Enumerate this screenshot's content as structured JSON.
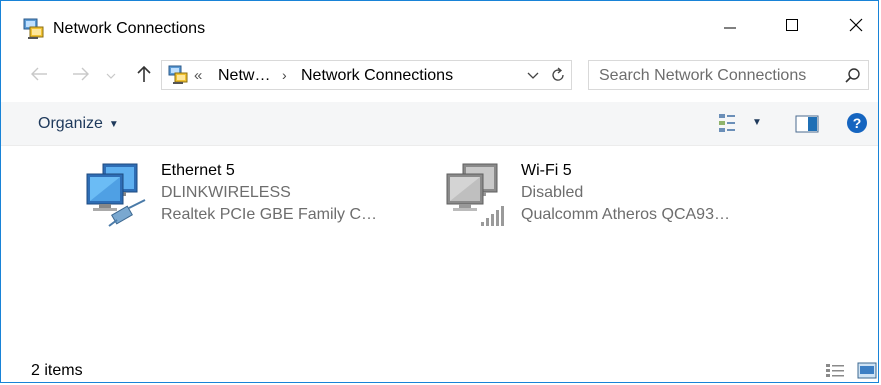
{
  "window": {
    "title": "Network Connections",
    "icon": "network-connections-icon"
  },
  "caption_buttons": {
    "minimize": "minimize-icon",
    "maximize": "maximize-icon",
    "close": "close-icon"
  },
  "nav": {
    "back": "back-arrow-icon",
    "forward": "forward-arrow-icon",
    "recent": "chevron-down-icon",
    "up": "up-arrow-icon"
  },
  "address": {
    "overflow": "«",
    "segment1": "Netw…",
    "separator": "›",
    "segment2": "Network Connections"
  },
  "search": {
    "placeholder": "Search Network Connections"
  },
  "command_bar": {
    "organize_label": "Organize"
  },
  "connections": [
    {
      "name": "Ethernet 5",
      "status": "DLINKWIRELESS",
      "device": "Realtek PCIe GBE Family C…",
      "icon": "ethernet-adapter-icon"
    },
    {
      "name": "Wi-Fi 5",
      "status": "Disabled",
      "device": "Qualcomm Atheros QCA93…",
      "icon": "wifi-adapter-disabled-icon"
    }
  ],
  "status_bar": {
    "count": "2 items"
  },
  "colors": {
    "window_border": "#1883d7",
    "command_bar_bg": "#f5f6f7",
    "link_text": "#1e395b",
    "secondary_text": "#6d6d6d",
    "help_blue": "#1565c0"
  }
}
